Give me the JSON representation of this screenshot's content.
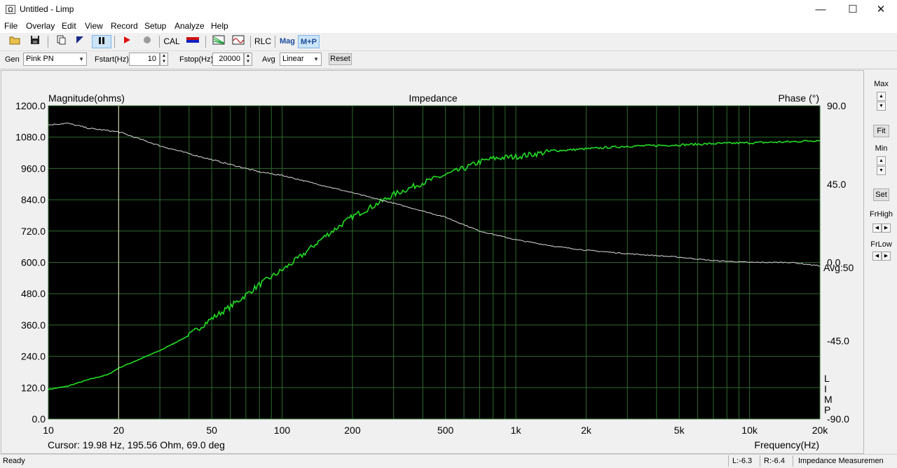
{
  "window": {
    "title": "Untitled - Limp",
    "icon": "Ω",
    "minimize": "—",
    "maximize": "☐",
    "close": "✕"
  },
  "menu": [
    "File",
    "Overlay",
    "Edit",
    "View",
    "Record",
    "Setup",
    "Analyze",
    "Help"
  ],
  "toolbar": {
    "cal": "CAL",
    "rlc": "RLC",
    "mag": "Mag",
    "mp": "M+P"
  },
  "genbar": {
    "gen_label": "Gen",
    "gen_value": "Pink PN",
    "fstart_label": "Fstart(Hz)",
    "fstart_value": "10",
    "fstop_label": "Fstop(Hz)",
    "fstop_value": "20000",
    "avg_label": "Avg",
    "avg_value": "Linear",
    "reset": "Reset"
  },
  "right_panel": {
    "max": "Max",
    "fit": "Fit",
    "min": "Min",
    "set": "Set",
    "frhigh": "FrHigh",
    "frlow": "FrLow"
  },
  "plot_labels": {
    "avg": "Avg:50",
    "cursor": "Cursor: 19.98 Hz, 195.56 Ohm, 69.0 deg",
    "side": [
      "L",
      "I",
      "M",
      "P"
    ]
  },
  "chart_data": {
    "type": "line",
    "title": "Impedance",
    "ylabel": "Magnitude(ohms)",
    "y2label": "Phase (°)",
    "xlabel": "Frequency(Hz)",
    "x_scale": "log",
    "xlim": [
      10,
      20000
    ],
    "ylim": [
      0,
      1200
    ],
    "y2lim": [
      -90,
      90
    ],
    "x_tick_labels": [
      {
        "v": 10,
        "t": "10"
      },
      {
        "v": 20,
        "t": "20"
      },
      {
        "v": 50,
        "t": "50"
      },
      {
        "v": 100,
        "t": "100"
      },
      {
        "v": 200,
        "t": "200"
      },
      {
        "v": 500,
        "t": "500"
      },
      {
        "v": 1000,
        "t": "1k"
      },
      {
        "v": 2000,
        "t": "2k"
      },
      {
        "v": 5000,
        "t": "5k"
      },
      {
        "v": 10000,
        "t": "10k"
      },
      {
        "v": 20000,
        "t": "20k"
      }
    ],
    "y_ticks": [
      "0.0",
      "120.0",
      "240.0",
      "360.0",
      "480.0",
      "600.0",
      "720.0",
      "840.0",
      "960.0",
      "1080.0",
      "1200.0"
    ],
    "y2_ticks": [
      {
        "v": 90,
        "t": "90.0"
      },
      {
        "v": 45,
        "t": "45.0"
      },
      {
        "v": 0,
        "t": "0.0"
      },
      {
        "v": -45,
        "t": "-45.0"
      },
      {
        "v": -90,
        "t": "-90.0"
      }
    ],
    "grid": true,
    "cursor_x": 19.98,
    "series": [
      {
        "role": "magnitude",
        "color": "#22dd22",
        "points": [
          [
            10,
            113
          ],
          [
            12,
            125
          ],
          [
            15,
            152
          ],
          [
            18,
            170
          ],
          [
            20,
            195
          ],
          [
            25,
            232
          ],
          [
            30,
            262
          ],
          [
            40,
            320
          ],
          [
            50,
            385
          ],
          [
            60,
            430
          ],
          [
            70,
            475
          ],
          [
            80,
            515
          ],
          [
            100,
            570
          ],
          [
            120,
            622
          ],
          [
            150,
            695
          ],
          [
            200,
            775
          ],
          [
            250,
            820
          ],
          [
            300,
            860
          ],
          [
            400,
            905
          ],
          [
            500,
            935
          ],
          [
            600,
            960
          ],
          [
            700,
            985
          ],
          [
            800,
            998
          ],
          [
            900,
            1002
          ],
          [
            1000,
            1005
          ],
          [
            1200,
            1015
          ],
          [
            1500,
            1028
          ],
          [
            2000,
            1035
          ],
          [
            3000,
            1045
          ],
          [
            5000,
            1050
          ],
          [
            7000,
            1055
          ],
          [
            10000,
            1058
          ],
          [
            15000,
            1062
          ],
          [
            20000,
            1068
          ]
        ]
      },
      {
        "role": "phase",
        "color": "#c8c8c8",
        "points": [
          [
            10,
            79
          ],
          [
            12,
            80
          ],
          [
            15,
            77
          ],
          [
            20,
            75
          ],
          [
            30,
            67
          ],
          [
            50,
            59
          ],
          [
            80,
            52
          ],
          [
            100,
            50
          ],
          [
            200,
            40
          ],
          [
            300,
            34
          ],
          [
            500,
            26
          ],
          [
            700,
            18
          ],
          [
            1000,
            13
          ],
          [
            1500,
            9
          ],
          [
            2000,
            7
          ],
          [
            3000,
            5
          ],
          [
            5000,
            3
          ],
          [
            7000,
            1
          ],
          [
            10000,
            0
          ],
          [
            15000,
            0
          ],
          [
            20000,
            -2
          ]
        ]
      }
    ]
  },
  "status": {
    "ready": "Ready",
    "left": "L:-6.3",
    "right": "R:-6.4",
    "mode": "Impedance Measuremen"
  }
}
